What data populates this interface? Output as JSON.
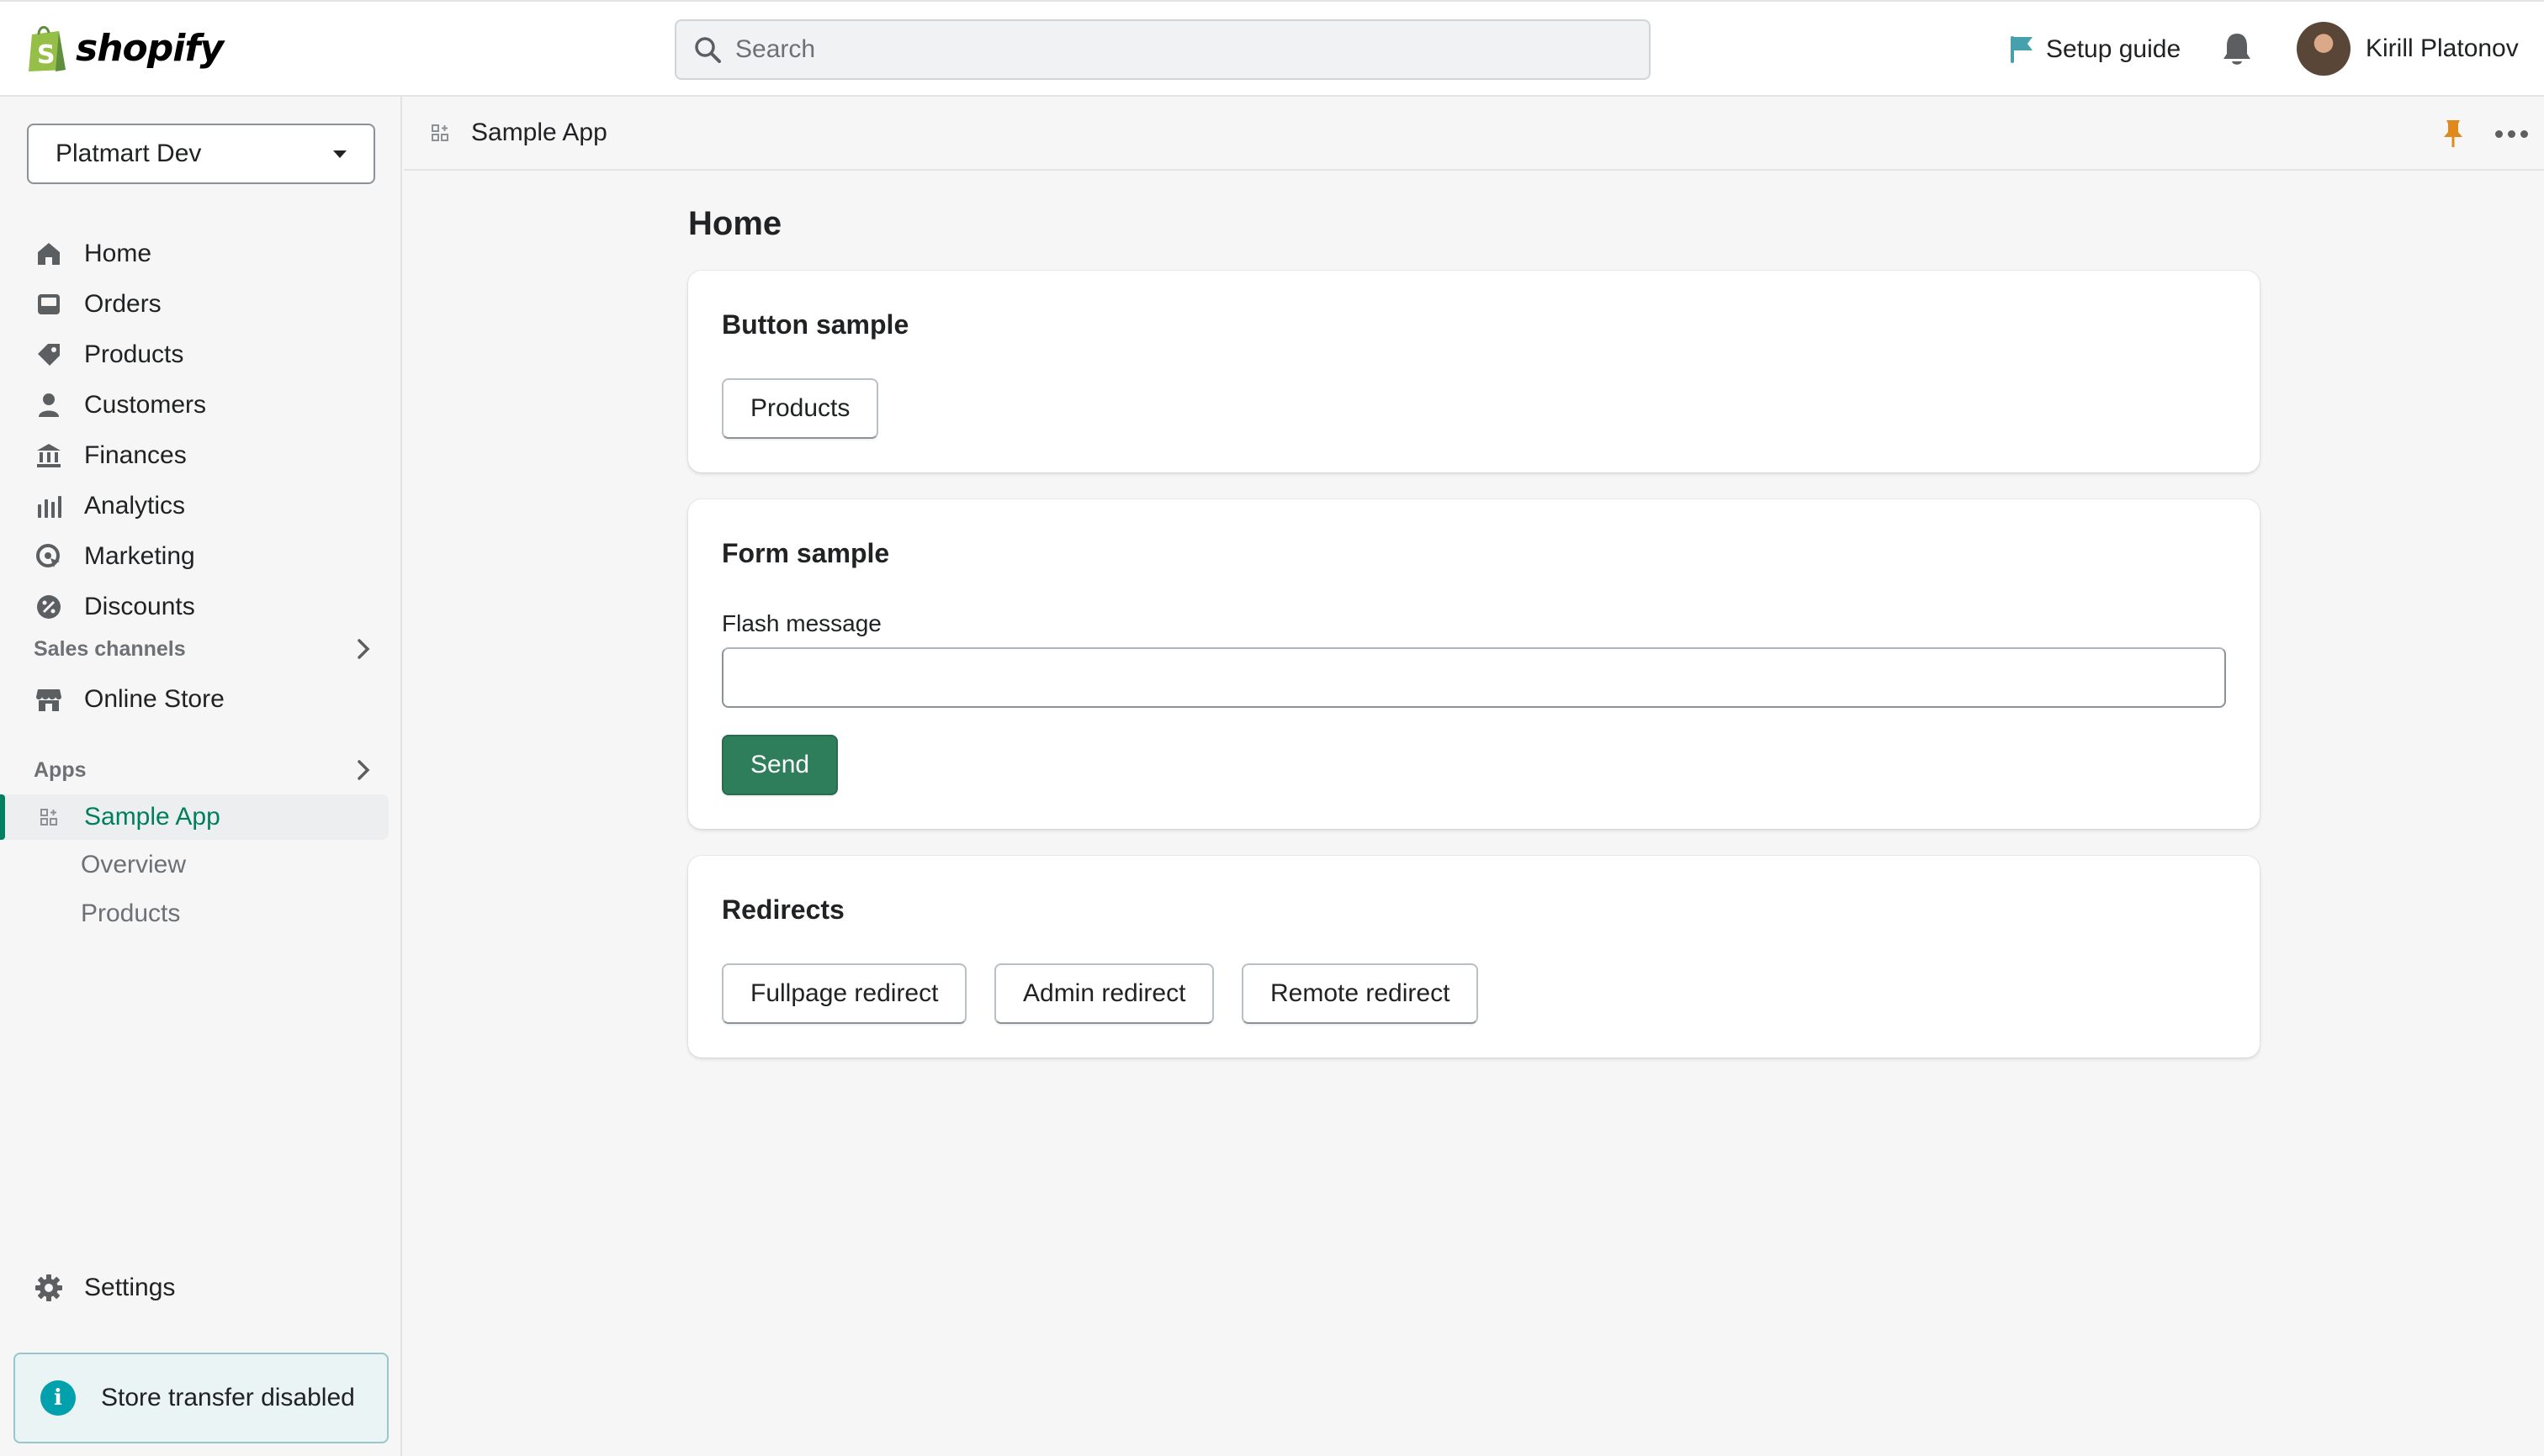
{
  "brand": {
    "name": "shopify",
    "logo_color": "#95bf47"
  },
  "search": {
    "placeholder": "Search"
  },
  "topbar": {
    "setup_guide": "Setup guide",
    "user_name": "Kirill Platonov"
  },
  "sidebar": {
    "store": "Platmart Dev",
    "items": [
      {
        "label": "Home",
        "icon": "home-icon"
      },
      {
        "label": "Orders",
        "icon": "inbox-icon"
      },
      {
        "label": "Products",
        "icon": "tag-icon"
      },
      {
        "label": "Customers",
        "icon": "person-icon"
      },
      {
        "label": "Finances",
        "icon": "bank-icon"
      },
      {
        "label": "Analytics",
        "icon": "bar-chart-icon"
      },
      {
        "label": "Marketing",
        "icon": "target-icon"
      },
      {
        "label": "Discounts",
        "icon": "discount-icon"
      }
    ],
    "sales_channels": {
      "heading": "Sales channels",
      "items": [
        {
          "label": "Online Store",
          "icon": "store-icon"
        }
      ]
    },
    "apps": {
      "heading": "Apps",
      "active": {
        "label": "Sample App",
        "icon": "app-icon"
      },
      "sub_items": [
        {
          "label": "Overview"
        },
        {
          "label": "Products"
        }
      ]
    },
    "settings": {
      "label": "Settings",
      "icon": "gear-icon"
    },
    "notice": {
      "text": "Store transfer disabled",
      "icon": "info-icon"
    }
  },
  "app_header": {
    "title": "Sample App"
  },
  "main": {
    "title": "Home",
    "button_card": {
      "title": "Button sample",
      "button": "Products"
    },
    "form_card": {
      "title": "Form sample",
      "label": "Flash message",
      "value": "",
      "submit": "Send"
    },
    "redirects_card": {
      "title": "Redirects",
      "buttons": [
        "Fullpage redirect",
        "Admin redirect",
        "Remote redirect"
      ]
    }
  },
  "colors": {
    "accent_green": "#008060",
    "primary_button": "#2e7d5b",
    "info_teal": "#00a0ac",
    "flag_teal": "#47a1ad",
    "pin_orange": "#e08a1e"
  }
}
